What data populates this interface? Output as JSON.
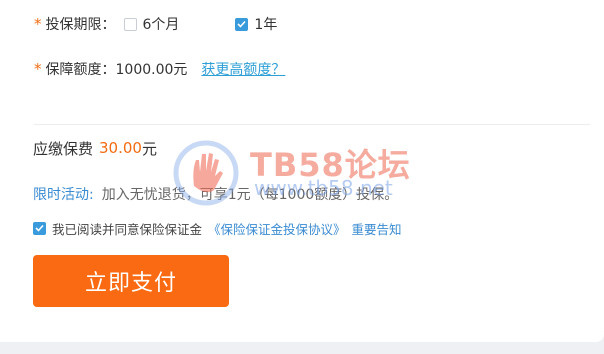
{
  "form": {
    "required_mark": "*",
    "period": {
      "label": "投保期限：",
      "options": [
        {
          "label": "6个月",
          "checked": false
        },
        {
          "label": "1年",
          "checked": true
        }
      ]
    },
    "amount": {
      "label": "保障额度：",
      "value": "1000.00元",
      "link": "获更高额度？"
    }
  },
  "fee": {
    "label": "应缴保费",
    "amount": "30.00",
    "unit": "元"
  },
  "promo": {
    "label": "限时活动:",
    "text": "加入无忧退货，可享1元（每1000额度）投保。"
  },
  "agreement": {
    "checked": true,
    "text": "我已阅读并同意保险保证金",
    "link1": "《保险保证金投保协议》",
    "link2": "重要告知"
  },
  "pay_button": {
    "label": "立即支付"
  },
  "watermark": {
    "title": "TB58论坛",
    "url": "www.tb58.net"
  },
  "colors": {
    "accent": "#f96a12",
    "link": "#2e9fd6",
    "checkbox": "#3a9bdc"
  }
}
